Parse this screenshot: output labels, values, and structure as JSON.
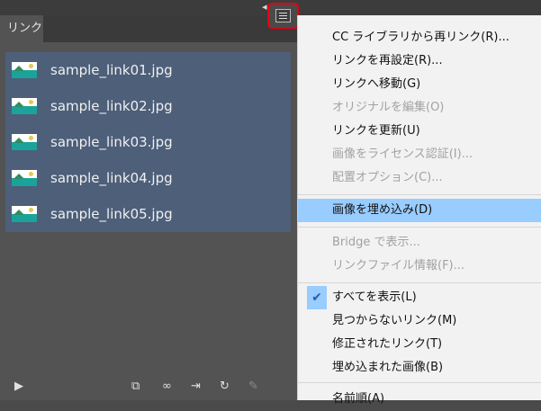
{
  "panel": {
    "tab_label": "リンク",
    "links": [
      {
        "name": "sample_link01.jpg"
      },
      {
        "name": "sample_link02.jpg"
      },
      {
        "name": "sample_link03.jpg"
      },
      {
        "name": "sample_link04.jpg"
      },
      {
        "name": "sample_link05.jpg"
      }
    ],
    "collapse_glyph": "◂◂",
    "close_glyph": "✕"
  },
  "menu": {
    "items": [
      {
        "label": "CC ライブラリから再リンク(R)...",
        "enabled": true
      },
      {
        "label": "リンクを再設定(R)...",
        "enabled": true
      },
      {
        "label": "リンクへ移動(G)",
        "enabled": true
      },
      {
        "label": "オリジナルを編集(O)",
        "enabled": false
      },
      {
        "label": "リンクを更新(U)",
        "enabled": true
      },
      {
        "label": "画像をライセンス認証(I)...",
        "enabled": false
      },
      {
        "label": "配置オプション(C)...",
        "enabled": false
      },
      {
        "label": "画像を埋め込み(D)",
        "enabled": true,
        "highlighted": true
      },
      {
        "label": "Bridge で表示...",
        "enabled": false
      },
      {
        "label": "リンクファイル情報(F)...",
        "enabled": false
      },
      {
        "label": "すべてを表示(L)",
        "enabled": true,
        "checked": true
      },
      {
        "label": "見つからないリンク(M)",
        "enabled": true
      },
      {
        "label": "修正されたリンク(T)",
        "enabled": true
      },
      {
        "label": "埋め込まれた画像(B)",
        "enabled": true
      },
      {
        "label": "名前順(A)",
        "enabled": true
      }
    ]
  },
  "colors": {
    "highlight": "#99ccff",
    "menu_button_outline": "#e60012",
    "selection": "#4d5f79"
  }
}
